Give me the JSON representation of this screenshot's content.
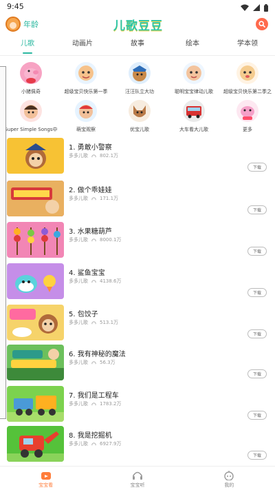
{
  "status_bar": {
    "time": "9:45"
  },
  "header": {
    "age_label": "年龄",
    "logo_text": "儿歌豆豆"
  },
  "tabs": [
    {
      "label": "儿歌"
    },
    {
      "label": "动画片"
    },
    {
      "label": "故事"
    },
    {
      "label": "绘本"
    },
    {
      "label": "学本领"
    }
  ],
  "characters": [
    {
      "name": "小猪佩奇",
      "color": "#f7a3c3"
    },
    {
      "name": "超级宝贝快乐第一季",
      "color": "#f6c28b"
    },
    {
      "name": "汪汪队立大功",
      "color": "#2e6db8"
    },
    {
      "name": "聪明宝宝律动儿歌",
      "color": "#f3c49e"
    },
    {
      "name": "超级宝贝快乐第二季之",
      "color": "#f5cc8f"
    },
    {
      "name": "Super Simple Songs中",
      "color": "#e1504a"
    },
    {
      "name": "萌宝观察",
      "color": "#e13a3a"
    },
    {
      "name": "优宝儿歌",
      "color": "#b97a48"
    },
    {
      "name": "大车看大儿歌",
      "color": "#d83232"
    },
    {
      "name": "更多",
      "color": "#f5a0c8"
    }
  ],
  "songs": [
    {
      "title": "1. 勇敢小警察",
      "artist": "多多儿歌",
      "plays": "802.1万",
      "download": "下载",
      "color": "#f7c234"
    },
    {
      "title": "2. 做个乖娃娃",
      "artist": "多多儿歌",
      "plays": "171.1万",
      "download": "下载",
      "color": "#c8414b"
    },
    {
      "title": "3. 水果糖葫芦",
      "artist": "多多儿歌",
      "plays": "8000.1万",
      "download": "下载",
      "color": "#f286b5"
    },
    {
      "title": "4. 鲨鱼宝宝",
      "artist": "多多儿歌",
      "plays": "4138.6万",
      "download": "下载",
      "color": "#c58ee8"
    },
    {
      "title": "5. 包饺子",
      "artist": "多多儿歌",
      "plays": "513.1万",
      "download": "下载",
      "color": "#f6d36a"
    },
    {
      "title": "6. 我有神秘的魔法",
      "artist": "多多儿歌",
      "plays": "56.3万",
      "download": "下载",
      "color": "#6cc05c"
    },
    {
      "title": "7. 我们是工程车",
      "artist": "多多儿歌",
      "plays": "1783.2万",
      "download": "下载",
      "color": "#7cd24e"
    },
    {
      "title": "8. 我是挖掘机",
      "artist": "多多儿歌",
      "plays": "6927.9万",
      "download": "下载",
      "color": "#55c23a"
    }
  ],
  "bottom_nav": [
    {
      "label": "宝宝看",
      "icon": "tv-icon"
    },
    {
      "label": "宝宝听",
      "icon": "headphones-icon"
    },
    {
      "label": "我的",
      "icon": "robot-face-icon"
    }
  ]
}
